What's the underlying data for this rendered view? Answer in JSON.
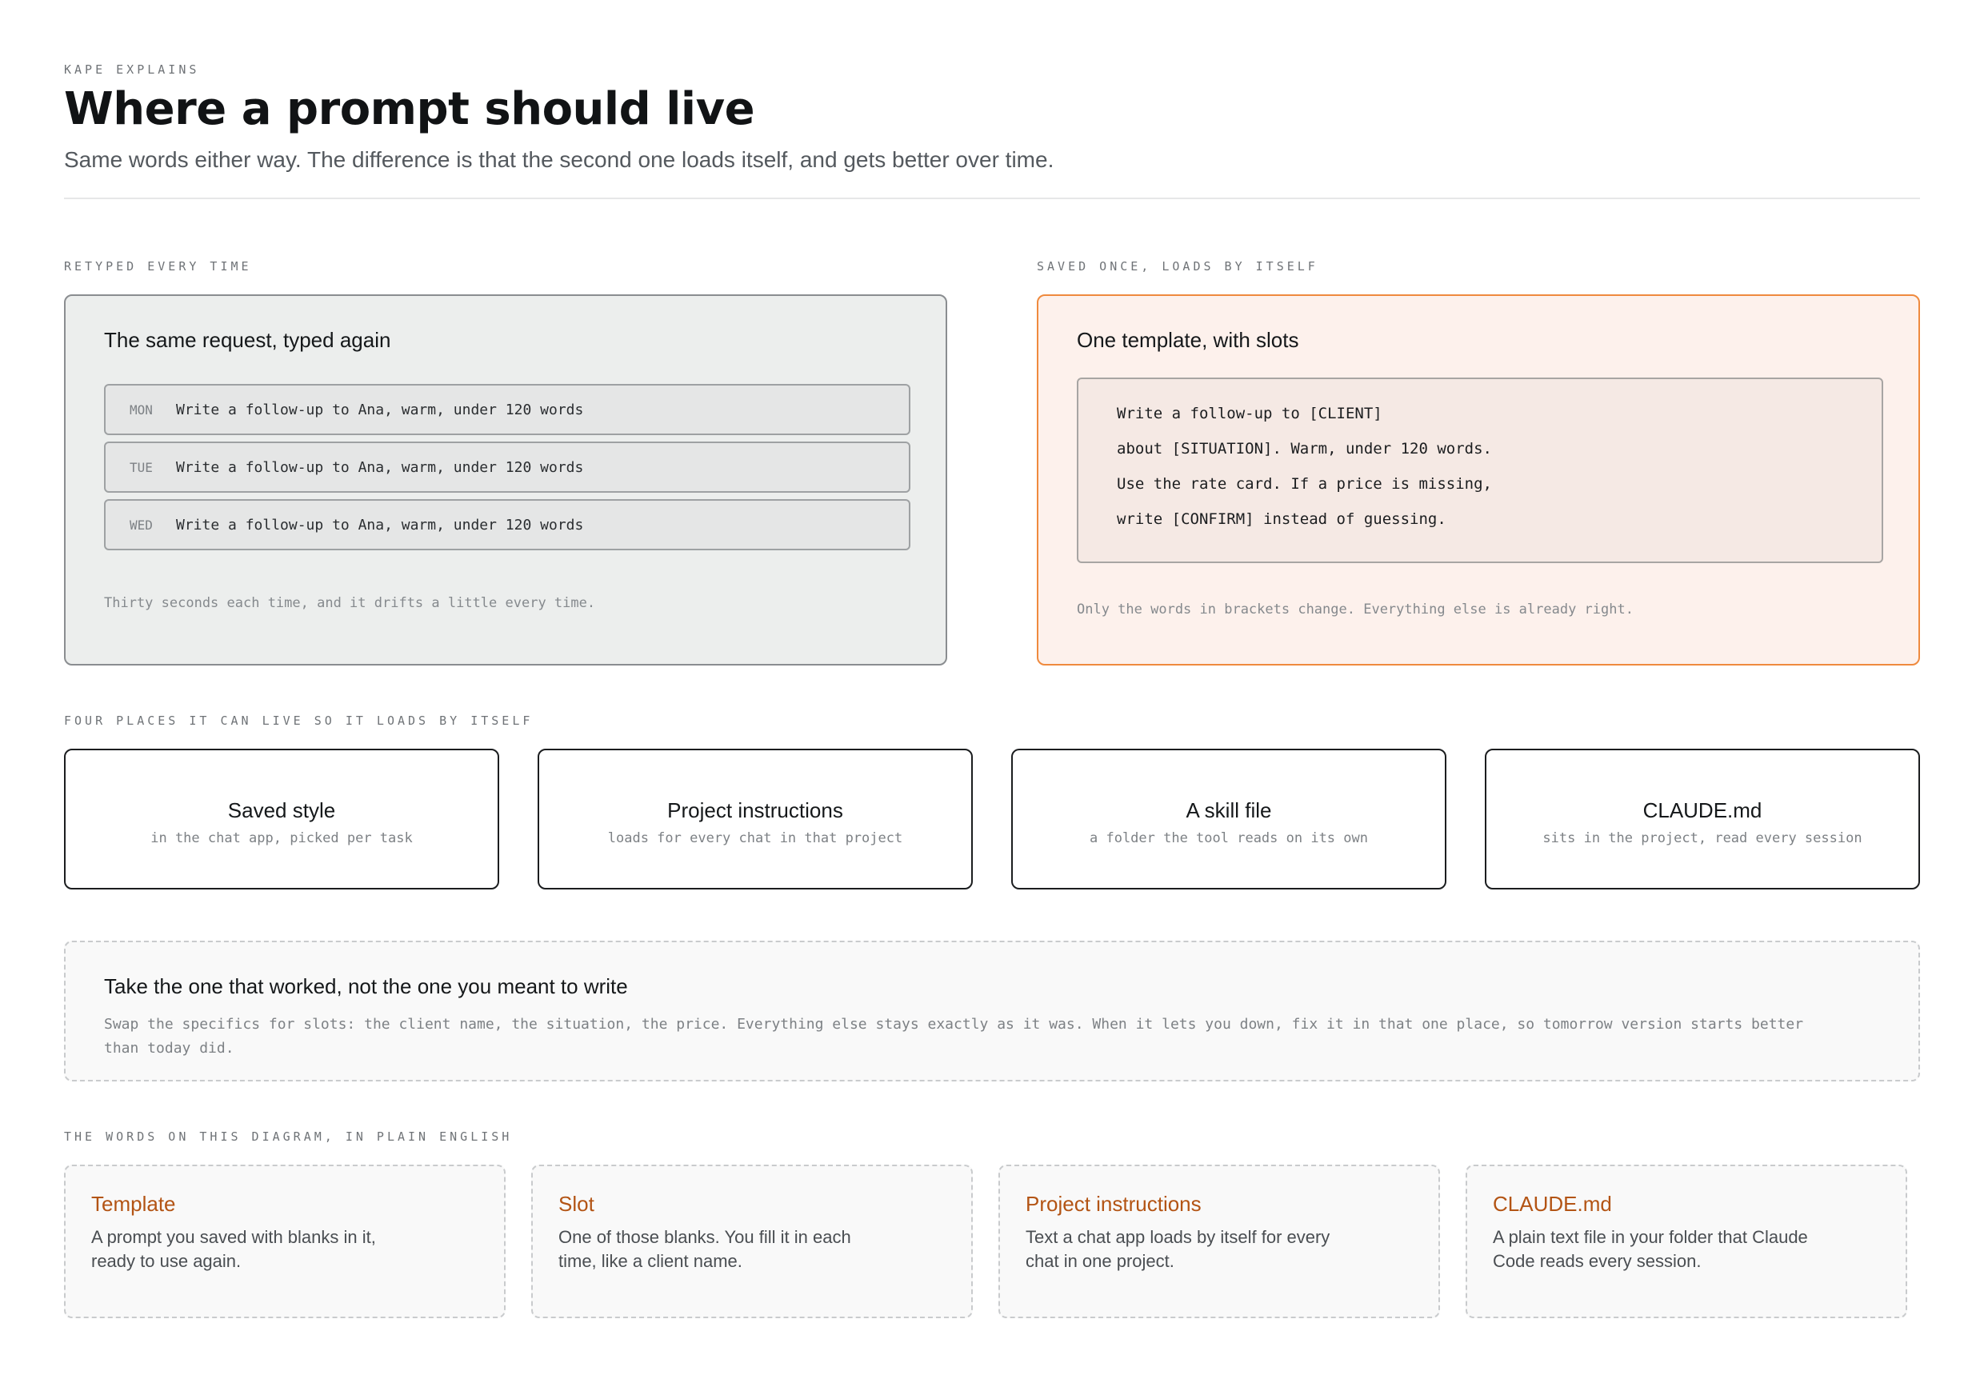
{
  "header": {
    "eyebrow": "KAPE EXPLAINS",
    "title": "Where a prompt should live",
    "subtitle": "Same words either way. The difference is that the second one loads itself, and gets better over time."
  },
  "retyped": {
    "label": "RETYPED EVERY TIME",
    "title": "The same request, typed again",
    "rows": [
      {
        "day": "MON",
        "text": "Write a follow-up to Ana, warm, under 120 words"
      },
      {
        "day": "TUE",
        "text": "Write a follow-up to Ana, warm, under 120 words"
      },
      {
        "day": "WED",
        "text": "Write a follow-up to Ana, warm, under 120 words"
      }
    ],
    "note": "Thirty seconds each time, and it drifts a little every time."
  },
  "saved": {
    "label": "SAVED ONCE, LOADS BY ITSELF",
    "title": "One template, with slots",
    "lines": [
      "Write a follow-up to [CLIENT]",
      "about [SITUATION]. Warm, under 120 words.",
      "Use the rate card. If a price is missing,",
      "write [CONFIRM] instead of guessing."
    ],
    "note": "Only the words in brackets change. Everything else is already right."
  },
  "places": {
    "label": "FOUR PLACES IT CAN LIVE SO IT LOADS BY ITSELF",
    "items": [
      {
        "name": "Saved style",
        "desc": "in the chat app, picked per task"
      },
      {
        "name": "Project instructions",
        "desc": "loads for every chat in that project"
      },
      {
        "name": "A skill file",
        "desc": "a folder the tool reads on its own"
      },
      {
        "name": "CLAUDE.md",
        "desc": "sits in the project, read every session"
      }
    ]
  },
  "tip": {
    "title": "Take the one that worked, not the one you meant to write",
    "body": "Swap the specifics for slots: the client name, the situation, the price. Everything else stays exactly as it was. When it lets you down, fix it in that one place, so tomorrow version starts better than today did."
  },
  "glossary": {
    "label": "THE WORDS ON THIS DIAGRAM, IN PLAIN ENGLISH",
    "terms": [
      {
        "term": "Template",
        "def": "A prompt you saved with blanks in it, ready to use again."
      },
      {
        "term": "Slot",
        "def": "One of those blanks. You fill it in each time, like a client name."
      },
      {
        "term": "Project instructions",
        "def": "Text a chat app loads by itself for every chat in one project."
      },
      {
        "term": "CLAUDE.md",
        "def": "A plain text file in your folder that Claude Code reads every session."
      }
    ]
  },
  "colors": {
    "accent": "#ef8a3e",
    "term_text": "#b35414",
    "saved_bg": "#fdf1ec",
    "retyped_bg": "#eceeed"
  }
}
